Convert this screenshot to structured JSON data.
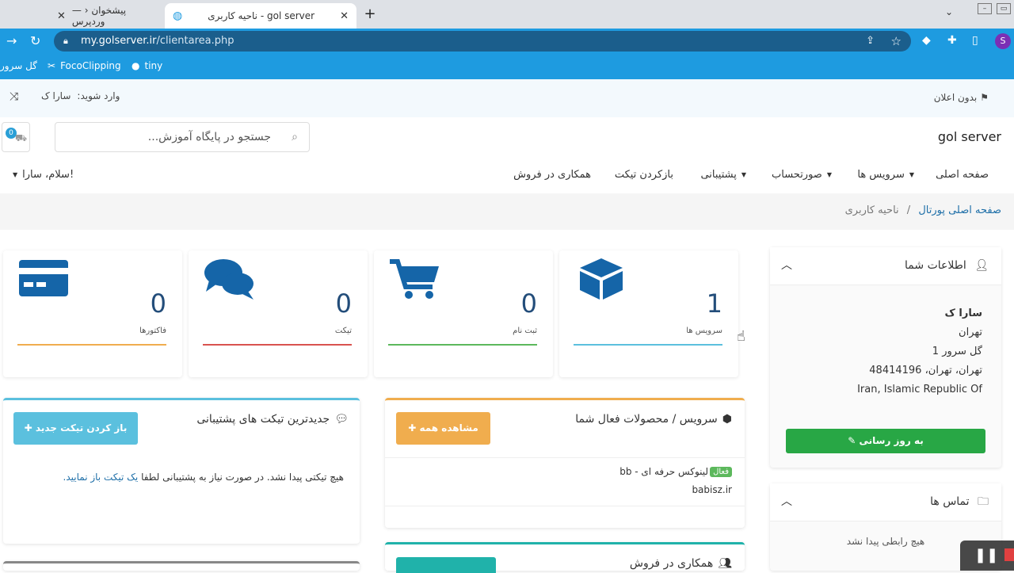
{
  "browser": {
    "tabs": [
      {
        "title": "پیشخوان ‹ — وردپرس"
      },
      {
        "title": "ناحیه کاربری - gol server"
      }
    ],
    "new_tab": "+",
    "url_domain": "my.golserver.ir",
    "url_path": "/clientarea.php",
    "profile_initial": "S",
    "bookmarks": [
      "گل سرور",
      "FocoClipping",
      "tiny"
    ]
  },
  "topbar": {
    "announcement": "بدون اعلان",
    "login_label": "وارد شوید:",
    "login_user": "سارا ک"
  },
  "header": {
    "brand": "gol server",
    "search_placeholder": "جستجو در پایگاه آموزش...",
    "cart_count": "0"
  },
  "nav": {
    "items": [
      "صفحه اصلی",
      "سرویس ها",
      "صورتحساب",
      "پشتیبانی",
      "بازکردن تیکت",
      "همکاری در فروش"
    ],
    "greeting": "سلام، سارا!"
  },
  "breadcrumb": {
    "home": "صفحه اصلی پورتال",
    "separator": "/",
    "current": "ناحیه کاربری"
  },
  "stats": [
    {
      "label": "سرویس ها",
      "value": "1",
      "color": "#5bc0de"
    },
    {
      "label": "ثبت نام",
      "value": "0",
      "color": "#5cb85c"
    },
    {
      "label": "تیکت",
      "value": "0",
      "color": "#d9534f"
    },
    {
      "label": "فاکتورها",
      "value": "0",
      "color": "#f0ad4e"
    }
  ],
  "account_panel": {
    "title": "اطلاعات شما",
    "name": "سارا ک",
    "city": "تهران",
    "company": "گل سرور 1",
    "address": "تهران، تهران، 48414196",
    "country": "Iran, Islamic Republic Of",
    "update_button": "به روز رسانی"
  },
  "contacts_panel": {
    "title": "تماس ها",
    "empty": "هیچ رابطی پیدا نشد"
  },
  "services_panel": {
    "title": "سرویس / محصولات فعال شما",
    "view_all": "مشاهده همه",
    "item_status": "فعال",
    "item_name": "لینوکس حرفه ای - bb",
    "item_domain": "babisz.ir"
  },
  "tickets_panel": {
    "title": "جدیدترین تیکت های پشتیبانی",
    "new_ticket": "باز کردن تیکت جدید",
    "empty_text": "هیچ تیکتی پیدا نشد. در صورت نیاز به پشتیبانی لطفا",
    "empty_link": "یک تیکت باز نمایید."
  },
  "affiliate_panel": {
    "title": "همکاری در فروش"
  },
  "colors": {
    "brand_blue": "#1e9be0",
    "card_icon": "#1565a8",
    "green": "#28a745",
    "orange": "#f0ad4e",
    "teal": "#5bc0de"
  }
}
